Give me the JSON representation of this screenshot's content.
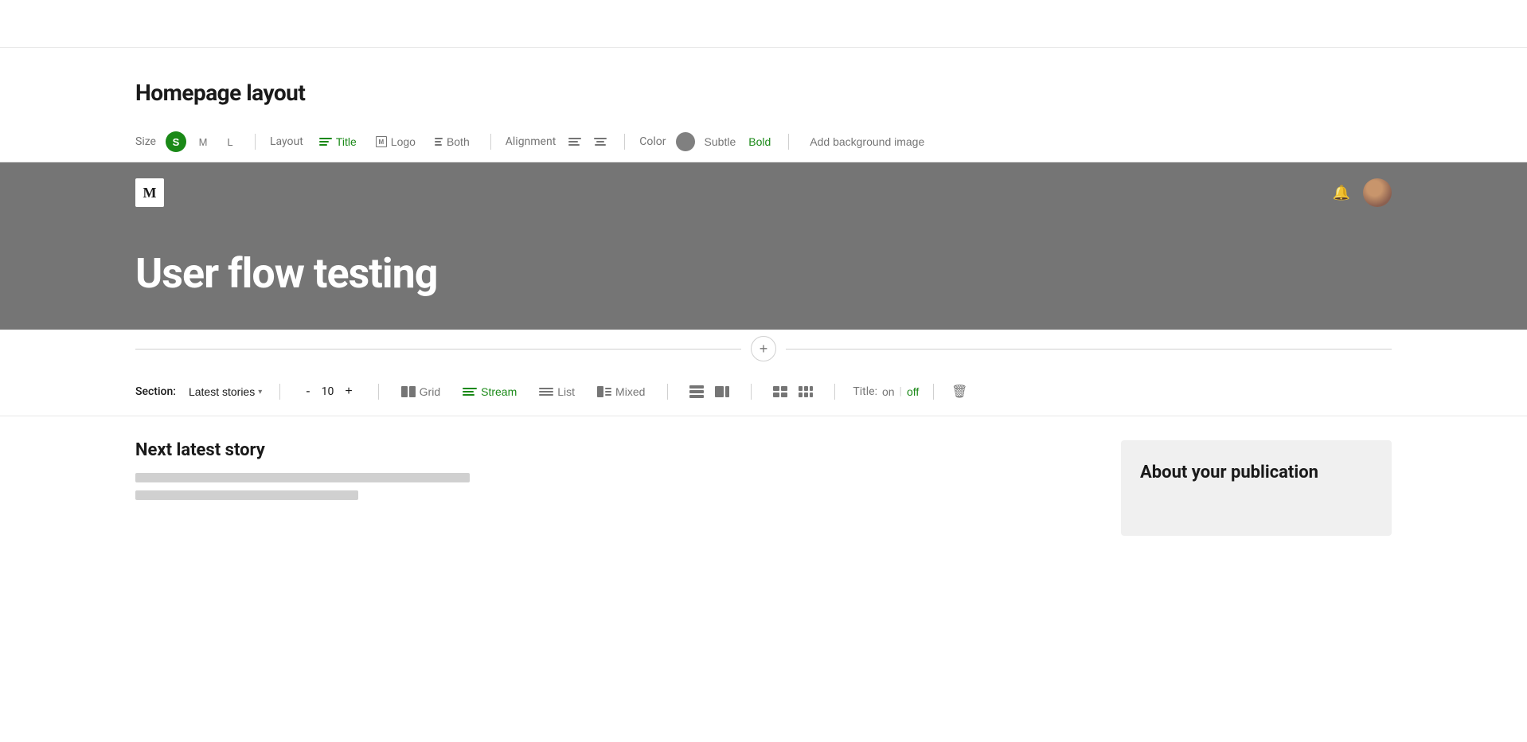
{
  "header": {
    "title": "Homepage layout"
  },
  "toolbar": {
    "size_label": "Size",
    "sizes": [
      "S",
      "M",
      "L"
    ],
    "active_size": "S",
    "layout_label": "Layout",
    "layouts": [
      "Title",
      "Logo",
      "Both"
    ],
    "active_layout": "Title",
    "alignment_label": "Alignment",
    "color_label": "Color",
    "color_options": [
      "Subtle",
      "Bold"
    ],
    "active_color": "Bold",
    "add_bg_label": "Add background image"
  },
  "preview": {
    "logo_letter": "M",
    "publication_title": "User flow testing"
  },
  "section_controls": {
    "section_label": "Section:",
    "section_value": "Latest stories",
    "count_minus": "-",
    "count_value": "10",
    "count_plus": "+",
    "views": [
      "Grid",
      "Stream",
      "List",
      "Mixed"
    ],
    "active_view": "Stream",
    "title_label": "Title:",
    "title_on": "on",
    "title_separator": "|",
    "title_off": "off"
  },
  "content": {
    "next_story_label": "Next latest story",
    "about_label": "About your publication"
  }
}
